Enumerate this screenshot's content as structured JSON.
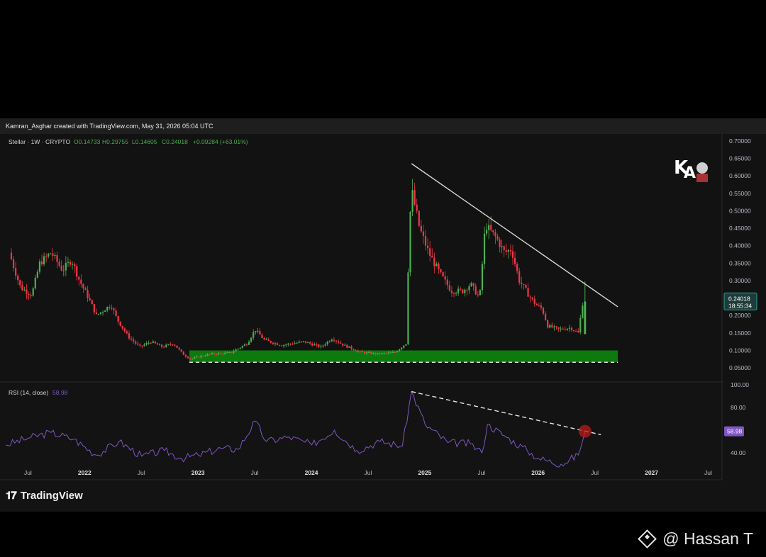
{
  "header": {
    "text": "Kamran_Asghar created with TradingView.com, May 31, 2026 05:04 UTC"
  },
  "legend": {
    "symbol": "Stellar · 1W · CRYPTO",
    "open": "O0.14733",
    "high": "H0.29755",
    "low": "L0.14605",
    "close": "C0.24018",
    "change": "+0.09284 (+63.01%)"
  },
  "price_badge": {
    "price": "0.24018",
    "countdown": "18:55:34"
  },
  "rsi": {
    "label": "RSI (14, close)",
    "value": "58.98"
  },
  "footer": {
    "brand": "TradingView"
  },
  "watermark": {
    "text": "@ Hassan T"
  },
  "colors": {
    "up": "#4caf50",
    "down": "#f23645",
    "support_zone": "#0d7a0d",
    "rsi_line": "#7e57c2",
    "rsi_badge": "#7e57c2",
    "trendline": "#d9d9d9",
    "price_badge": "#26a69a"
  },
  "chart_data": [
    {
      "type": "candlestick",
      "title": "",
      "interval": "1W",
      "x_ticks": [
        "Jul",
        "2022",
        "Jul",
        "2023",
        "Jul",
        "2024",
        "Jul",
        "2025",
        "Jul",
        "2026",
        "Jul",
        "2027",
        "Jul"
      ],
      "y_ticks": [
        "0.70000",
        "0.65000",
        "0.60000",
        "0.55000",
        "0.50000",
        "0.45000",
        "0.40000",
        "0.35000",
        "0.30000",
        "0.25000",
        "0.20000",
        "0.15000",
        "0.10000",
        "0.05000"
      ],
      "ylim": [
        0.03,
        0.72
      ],
      "price_series": [
        {
          "t": 2021.35,
          "p": 0.38
        },
        {
          "t": 2021.45,
          "p": 0.28
        },
        {
          "t": 2021.55,
          "p": 0.26
        },
        {
          "t": 2021.62,
          "p": 0.35
        },
        {
          "t": 2021.72,
          "p": 0.38
        },
        {
          "t": 2021.82,
          "p": 0.33
        },
        {
          "t": 2021.9,
          "p": 0.36
        },
        {
          "t": 2021.97,
          "p": 0.3
        },
        {
          "t": 2022.05,
          "p": 0.25
        },
        {
          "t": 2022.12,
          "p": 0.2
        },
        {
          "t": 2022.2,
          "p": 0.22
        },
        {
          "t": 2022.25,
          "p": 0.23
        },
        {
          "t": 2022.3,
          "p": 0.19
        },
        {
          "t": 2022.4,
          "p": 0.14
        },
        {
          "t": 2022.5,
          "p": 0.11
        },
        {
          "t": 2022.6,
          "p": 0.125
        },
        {
          "t": 2022.7,
          "p": 0.11
        },
        {
          "t": 2022.8,
          "p": 0.12
        },
        {
          "t": 2022.88,
          "p": 0.09
        },
        {
          "t": 2022.95,
          "p": 0.075
        },
        {
          "t": 2023.05,
          "p": 0.085
        },
        {
          "t": 2023.15,
          "p": 0.09
        },
        {
          "t": 2023.3,
          "p": 0.093
        },
        {
          "t": 2023.45,
          "p": 0.12
        },
        {
          "t": 2023.52,
          "p": 0.16
        },
        {
          "t": 2023.6,
          "p": 0.13
        },
        {
          "t": 2023.75,
          "p": 0.115
        },
        {
          "t": 2023.85,
          "p": 0.12
        },
        {
          "t": 2023.95,
          "p": 0.125
        },
        {
          "t": 2024.1,
          "p": 0.11
        },
        {
          "t": 2024.2,
          "p": 0.135
        },
        {
          "t": 2024.3,
          "p": 0.115
        },
        {
          "t": 2024.45,
          "p": 0.095
        },
        {
          "t": 2024.6,
          "p": 0.09
        },
        {
          "t": 2024.75,
          "p": 0.094
        },
        {
          "t": 2024.85,
          "p": 0.12
        },
        {
          "t": 2024.88,
          "p": 0.45
        },
        {
          "t": 2024.9,
          "p": 0.56
        },
        {
          "t": 2024.97,
          "p": 0.45
        },
        {
          "t": 2025.05,
          "p": 0.38
        },
        {
          "t": 2025.15,
          "p": 0.32
        },
        {
          "t": 2025.25,
          "p": 0.27
        },
        {
          "t": 2025.35,
          "p": 0.27
        },
        {
          "t": 2025.42,
          "p": 0.29
        },
        {
          "t": 2025.5,
          "p": 0.25
        },
        {
          "t": 2025.55,
          "p": 0.46
        },
        {
          "t": 2025.65,
          "p": 0.42
        },
        {
          "t": 2025.72,
          "p": 0.38
        },
        {
          "t": 2025.78,
          "p": 0.39
        },
        {
          "t": 2025.85,
          "p": 0.3
        },
        {
          "t": 2025.95,
          "p": 0.25
        },
        {
          "t": 2026.0,
          "p": 0.23
        },
        {
          "t": 2026.05,
          "p": 0.22
        },
        {
          "t": 2026.1,
          "p": 0.17
        },
        {
          "t": 2026.2,
          "p": 0.16
        },
        {
          "t": 2026.3,
          "p": 0.165
        },
        {
          "t": 2026.37,
          "p": 0.15
        },
        {
          "t": 2026.41,
          "p": 0.24
        }
      ],
      "support_zone": {
        "low": 0.066,
        "high": 0.1,
        "t_start": 2022.92,
        "t_end": 2026.7
      },
      "dashed_support": 0.066,
      "trendline": [
        {
          "t": 2024.88,
          "p": 0.635
        },
        {
          "t": 2026.7,
          "p": 0.225
        }
      ],
      "last_price": 0.24018
    },
    {
      "type": "line",
      "title": "RSI (14, close)",
      "y_ticks": [
        "100.00",
        "80.00",
        "40.00"
      ],
      "ylim": [
        25,
        100
      ],
      "last_value": 58.98,
      "series_points": [
        {
          "t": 2021.3,
          "v": 47
        },
        {
          "t": 2021.5,
          "v": 53
        },
        {
          "t": 2021.7,
          "v": 58
        },
        {
          "t": 2021.9,
          "v": 52
        },
        {
          "t": 2022.1,
          "v": 38
        },
        {
          "t": 2022.3,
          "v": 50
        },
        {
          "t": 2022.5,
          "v": 37
        },
        {
          "t": 2022.7,
          "v": 42
        },
        {
          "t": 2022.85,
          "v": 35
        },
        {
          "t": 2023.0,
          "v": 38
        },
        {
          "t": 2023.2,
          "v": 44
        },
        {
          "t": 2023.35,
          "v": 43
        },
        {
          "t": 2023.5,
          "v": 68
        },
        {
          "t": 2023.6,
          "v": 50
        },
        {
          "t": 2023.8,
          "v": 54
        },
        {
          "t": 2024.0,
          "v": 47
        },
        {
          "t": 2024.2,
          "v": 60
        },
        {
          "t": 2024.4,
          "v": 42
        },
        {
          "t": 2024.6,
          "v": 50
        },
        {
          "t": 2024.8,
          "v": 46
        },
        {
          "t": 2024.88,
          "v": 94
        },
        {
          "t": 2025.0,
          "v": 65
        },
        {
          "t": 2025.2,
          "v": 49
        },
        {
          "t": 2025.4,
          "v": 48
        },
        {
          "t": 2025.5,
          "v": 40
        },
        {
          "t": 2025.55,
          "v": 65
        },
        {
          "t": 2025.7,
          "v": 55
        },
        {
          "t": 2025.9,
          "v": 42
        },
        {
          "t": 2026.0,
          "v": 35
        },
        {
          "t": 2026.2,
          "v": 30
        },
        {
          "t": 2026.35,
          "v": 38
        },
        {
          "t": 2026.41,
          "v": 59
        }
      ],
      "trendline": [
        {
          "t": 2024.88,
          "v": 94
        },
        {
          "t": 2026.55,
          "v": 56
        }
      ],
      "highlight_point": {
        "t": 2026.41,
        "v": 59
      }
    }
  ]
}
